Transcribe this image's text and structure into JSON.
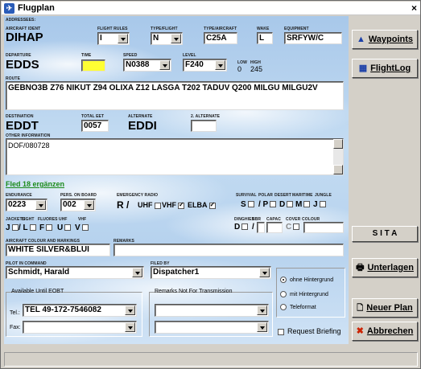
{
  "window": {
    "title": "Flugplan",
    "close": "×"
  },
  "labels": {
    "addressees": "ADDRESSEES:",
    "aircraft_ident": "AIRCRAFT IDENT",
    "flight_rules": "FLIGHT RULES",
    "type_of_flight": "TYPE/FLIGHT",
    "type_of_aircraft": "TYPE/AIRCRAFT",
    "wake": "WAKE",
    "equipment": "EQUIPMENT",
    "departure": "DEPARTURE",
    "time": "TIME",
    "speed": "SPEED",
    "level": "LEVEL",
    "low": "LOW",
    "high": "HIGH",
    "route": "ROUTE",
    "destination": "DESTINATION",
    "total_eet": "TOTAL EET",
    "alternate": "ALTERNATE",
    "alternate2": "2. ALTERNATE",
    "other_information": "OTHER INFORMATION",
    "endurance": "ENDURANCE",
    "pers_on_board": "PERS. ON BOARD",
    "emergency_radio": "EMERGENCY RADIO",
    "survival": "SURVIVAL",
    "polar": "POLAR",
    "desert": "DESERT",
    "maritime": "MARITIME",
    "jungle": "JUNGLE",
    "jackets": "JACKETS",
    "light": "LIGHT",
    "fluores": "FLUORES",
    "uhf": "UHF",
    "vhf": "VHF",
    "dinghies": "DINGHIES",
    "nbr": "NBR",
    "capac": "CAPAC",
    "cover": "COVER",
    "colour": "COLOUR",
    "aircraft_colour": "AIRCRAFT COLOUR AND MARKINGS",
    "remarks": "REMARKS",
    "pilot_in_command": "PILOT IN COMMAND",
    "filed_by": "FILED BY"
  },
  "values": {
    "aircraft_ident": "DIHAP",
    "flight_rules": "I",
    "type_of_flight": "N",
    "type_of_aircraft": "C25A",
    "wake": "L",
    "equipment": "SRFYW/C",
    "departure": "EDDS",
    "time": "",
    "speed": "N0388",
    "level": "F240",
    "low": "0",
    "high": "245",
    "route": "GEBNO3B Z76 NIKUT Z94 OLIXA Z12 LASGA T202 TADUV Q200 MILGU MILGU2V",
    "destination": "EDDT",
    "total_eet": "0057",
    "alternate": "EDDI",
    "alternate2": "",
    "other_information": "DOF/080728",
    "endurance": "0223",
    "pers_on_board": "002",
    "aircraft_colour": "WHITE SILVER&BLUI",
    "remarks": "",
    "pilot_in_command": "Schmidt, Harald",
    "filed_by": "Dispatcher1",
    "tel": "TEL 49-172-7546082",
    "fax": "",
    "remarks_transmission_1": "",
    "remarks_transmission_2": ""
  },
  "checks": {
    "r_label": "R /",
    "uhf_label": "UHF",
    "vhf_label": "VHF",
    "elba_label": "ELBA",
    "s_label": "S",
    "p_label": "/ P",
    "d_label": "D",
    "m_label": "M",
    "j_label": "J",
    "jj_label": "J",
    "jl_label": "/ L",
    "jf_label": "F",
    "ju_label": "U",
    "jv_label": "V",
    "dd_label": "D",
    "dslash": "/",
    "cc_label": "C"
  },
  "links": {
    "fled18": "Fled 18 ergänzen"
  },
  "groups": {
    "available_until": "Available Until EOBT",
    "remarks_not": "Remarks Not For Transmission",
    "tel": "Tel.:",
    "fax": "Fax:"
  },
  "radios": {
    "ohne": "ohne Hintergrund",
    "mit": "mit Hintergrund",
    "tele": "Teleformat"
  },
  "request_briefing": "Request Briefing",
  "buttons": {
    "waypoints": "Waypoints",
    "flightlog": "FlightLog",
    "sita": "S I T A",
    "unterlagen": "Unterlagen",
    "neuer_plan": "Neuer Plan",
    "abbrechen": "Abbrechen"
  },
  "icons": {
    "waypoints": "triangle-icon",
    "flightlog": "table-icon",
    "unterlagen": "printer-icon",
    "neuer_plan": "document-icon",
    "abbrechen": "x-icon",
    "close": "close-icon",
    "title": "app-icon"
  }
}
